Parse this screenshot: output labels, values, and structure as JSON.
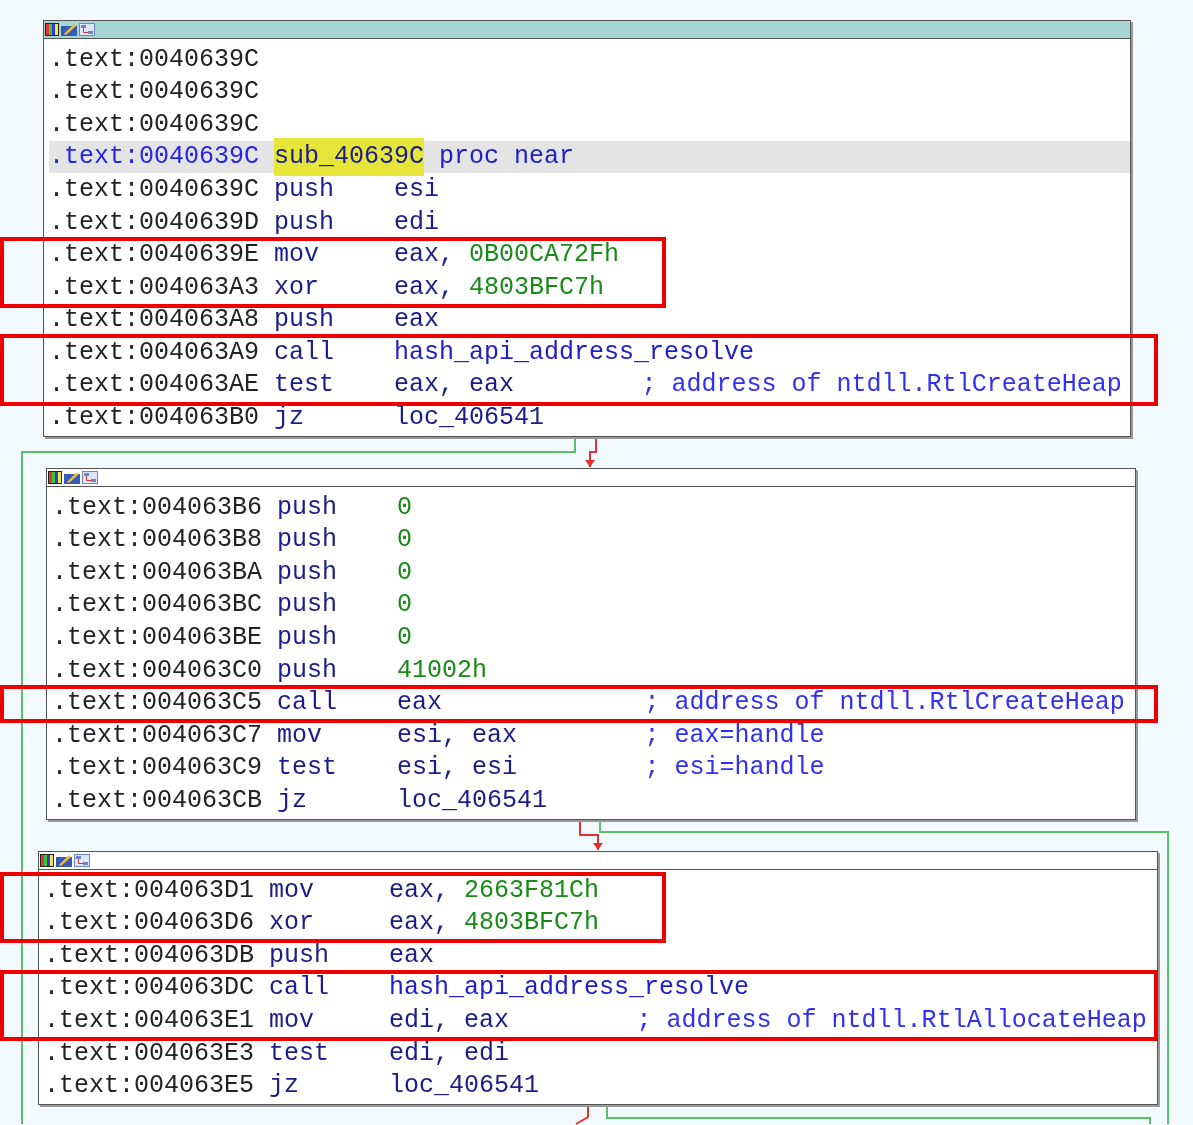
{
  "blocks": [
    {
      "selected": true,
      "rows": [
        {
          "kind": "line",
          "address": ".text:0040639C",
          "selected": false
        },
        {
          "kind": "line",
          "address": ".text:0040639C",
          "selected": false
        },
        {
          "kind": "line",
          "address": ".text:0040639C",
          "selected": false
        },
        {
          "kind": "proc",
          "address": ".text:0040639C",
          "label": "sub_40639C",
          "directive": "proc near",
          "selected": true
        },
        {
          "kind": "line",
          "address": ".text:0040639C",
          "mnemonic": "push",
          "operands": [
            {
              "text": "esi",
              "kind": "reg"
            }
          ],
          "selected": false
        },
        {
          "kind": "line",
          "address": ".text:0040639D",
          "mnemonic": "push",
          "operands": [
            {
              "text": "edi",
              "kind": "reg"
            }
          ],
          "selected": false
        },
        {
          "kind": "highlight",
          "wide": false,
          "rows": [
            {
              "kind": "line",
              "address": ".text:0040639E",
              "mnemonic": "mov",
              "operands": [
                {
                  "text": "eax,",
                  "kind": "reg"
                },
                {
                  "text": "0B00CA72Fh",
                  "kind": "num"
                }
              ],
              "selected": false
            },
            {
              "kind": "line",
              "address": ".text:004063A3",
              "mnemonic": "xor",
              "operands": [
                {
                  "text": "eax,",
                  "kind": "reg"
                },
                {
                  "text": "4803BFC7h",
                  "kind": "num"
                }
              ],
              "selected": false
            }
          ]
        },
        {
          "kind": "line",
          "address": ".text:004063A8",
          "mnemonic": "push",
          "operands": [
            {
              "text": "eax",
              "kind": "reg"
            }
          ],
          "selected": false
        },
        {
          "kind": "highlight",
          "wide": true,
          "rows": [
            {
              "kind": "line",
              "address": ".text:004063A9",
              "mnemonic": "call",
              "operands": [
                {
                  "text": "hash_api_address_resolve",
                  "kind": "name"
                }
              ],
              "selected": false
            },
            {
              "kind": "line",
              "address": ".text:004063AE",
              "mnemonic": "test",
              "operands": [
                {
                  "text": "eax,",
                  "kind": "reg"
                },
                {
                  "text": "eax",
                  "kind": "reg"
                }
              ],
              "comment": "; address of ntdll.RtlCreateHeap",
              "selected": false
            }
          ]
        },
        {
          "kind": "line",
          "address": ".text:004063B0",
          "mnemonic": "jz",
          "operands": [
            {
              "text": "loc_406541",
              "kind": "reg"
            }
          ],
          "selected": false
        }
      ]
    },
    {
      "selected": false,
      "rows": [
        {
          "kind": "line",
          "address": ".text:004063B6",
          "mnemonic": "push",
          "operands": [
            {
              "text": "0",
              "kind": "num"
            }
          ],
          "selected": false
        },
        {
          "kind": "line",
          "address": ".text:004063B8",
          "mnemonic": "push",
          "operands": [
            {
              "text": "0",
              "kind": "num"
            }
          ],
          "selected": false
        },
        {
          "kind": "line",
          "address": ".text:004063BA",
          "mnemonic": "push",
          "operands": [
            {
              "text": "0",
              "kind": "num"
            }
          ],
          "selected": false
        },
        {
          "kind": "line",
          "address": ".text:004063BC",
          "mnemonic": "push",
          "operands": [
            {
              "text": "0",
              "kind": "num"
            }
          ],
          "selected": false
        },
        {
          "kind": "line",
          "address": ".text:004063BE",
          "mnemonic": "push",
          "operands": [
            {
              "text": "0",
              "kind": "num"
            }
          ],
          "selected": false
        },
        {
          "kind": "line",
          "address": ".text:004063C0",
          "mnemonic": "push",
          "operands": [
            {
              "text": "41002h",
              "kind": "num"
            }
          ],
          "selected": false
        },
        {
          "kind": "highlight",
          "wide": true,
          "rows": [
            {
              "kind": "line",
              "address": ".text:004063C5",
              "mnemonic": "call",
              "operands": [
                {
                  "text": "eax",
                  "kind": "reg"
                }
              ],
              "comment": "; address of ntdll.RtlCreateHeap",
              "selected": false
            }
          ]
        },
        {
          "kind": "line",
          "address": ".text:004063C7",
          "mnemonic": "mov",
          "operands": [
            {
              "text": "esi,",
              "kind": "reg"
            },
            {
              "text": "eax",
              "kind": "reg"
            }
          ],
          "comment": "; eax=handle",
          "selected": false
        },
        {
          "kind": "line",
          "address": ".text:004063C9",
          "mnemonic": "test",
          "operands": [
            {
              "text": "esi,",
              "kind": "reg"
            },
            {
              "text": "esi",
              "kind": "reg"
            }
          ],
          "comment": "; esi=handle",
          "selected": false
        },
        {
          "kind": "line",
          "address": ".text:004063CB",
          "mnemonic": "jz",
          "operands": [
            {
              "text": "loc_406541",
              "kind": "reg"
            }
          ],
          "selected": false
        }
      ]
    },
    {
      "selected": false,
      "rows": [
        {
          "kind": "highlight",
          "wide": false,
          "rows": [
            {
              "kind": "line",
              "address": ".text:004063D1",
              "mnemonic": "mov",
              "operands": [
                {
                  "text": "eax,",
                  "kind": "reg"
                },
                {
                  "text": "2663F81Ch",
                  "kind": "num"
                }
              ],
              "selected": false
            },
            {
              "kind": "line",
              "address": ".text:004063D6",
              "mnemonic": "xor",
              "operands": [
                {
                  "text": "eax,",
                  "kind": "reg"
                },
                {
                  "text": "4803BFC7h",
                  "kind": "num"
                }
              ],
              "selected": false
            }
          ]
        },
        {
          "kind": "line",
          "address": ".text:004063DB",
          "mnemonic": "push",
          "operands": [
            {
              "text": "eax",
              "kind": "reg"
            }
          ],
          "selected": false
        },
        {
          "kind": "highlight",
          "wide": true,
          "rows": [
            {
              "kind": "line",
              "address": ".text:004063DC",
              "mnemonic": "call",
              "operands": [
                {
                  "text": "hash_api_address_resolve",
                  "kind": "name"
                }
              ],
              "selected": false
            },
            {
              "kind": "line",
              "address": ".text:004063E1",
              "mnemonic": "mov",
              "operands": [
                {
                  "text": "edi,",
                  "kind": "reg"
                },
                {
                  "text": "eax",
                  "kind": "reg"
                }
              ],
              "comment": "; address of ntdll.RtlAllocateHeap",
              "selected": false
            }
          ]
        },
        {
          "kind": "line",
          "address": ".text:004063E3",
          "mnemonic": "test",
          "operands": [
            {
              "text": "edi,",
              "kind": "reg"
            },
            {
              "text": "edi",
              "kind": "reg"
            }
          ],
          "selected": false
        },
        {
          "kind": "line",
          "address": ".text:004063E5",
          "mnemonic": "jz",
          "operands": [
            {
              "text": "loc_406541",
              "kind": "reg"
            }
          ],
          "selected": false
        }
      ]
    }
  ]
}
